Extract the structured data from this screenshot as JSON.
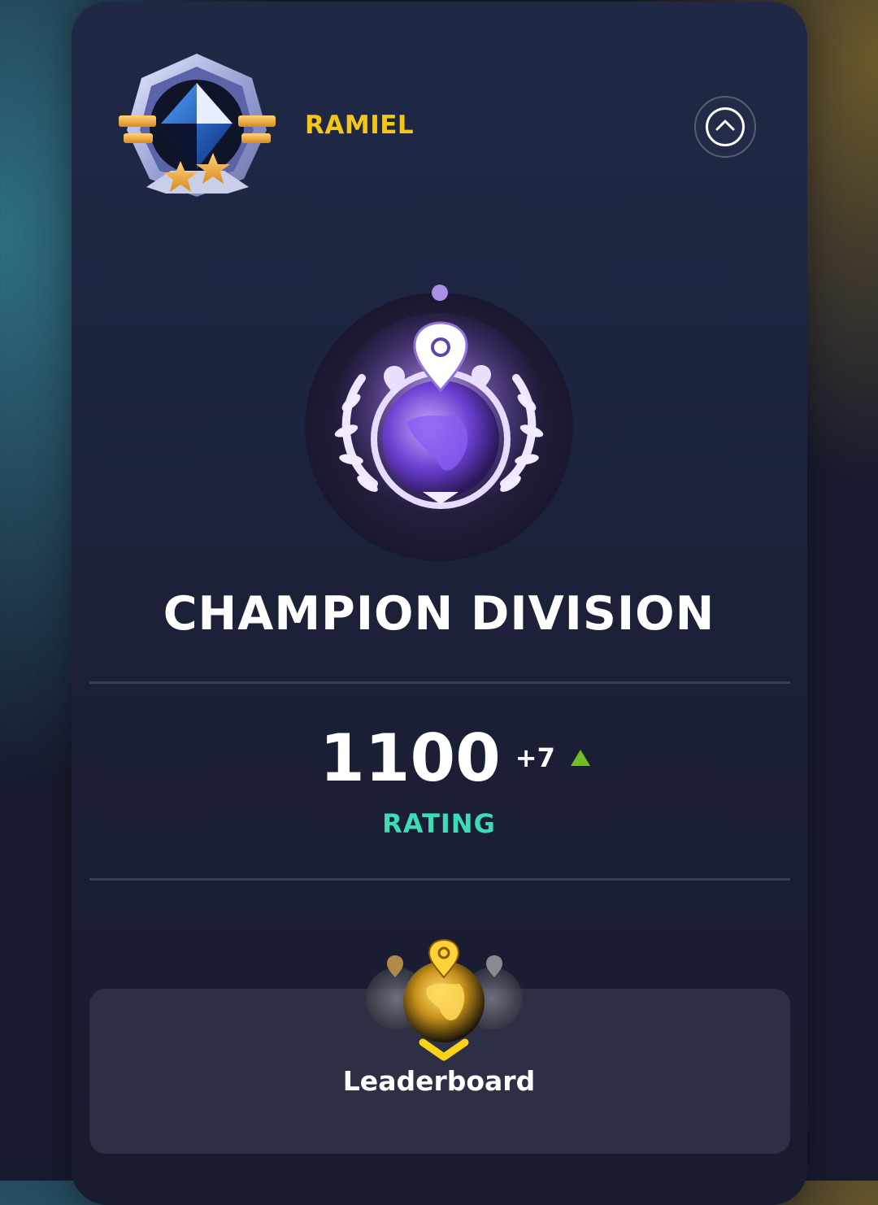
{
  "player": {
    "name": "RAMIEL",
    "name_color": "#f5c518"
  },
  "header": {
    "collapse_icon": "chevron-up-circle-icon",
    "rank_badge_icon": "rank-badge-2-stars-icon"
  },
  "division": {
    "title": "CHAMPION DIVISION",
    "emblem_icon": "globe-laurel-emblem-icon"
  },
  "rating": {
    "value": "1100",
    "delta": "+7",
    "trend": "up",
    "trend_color": "#6fbf20",
    "label": "RATING",
    "label_color": "#3ddbb6"
  },
  "leaderboard": {
    "label": "Leaderboard",
    "icon": "golden-globe-icon"
  }
}
